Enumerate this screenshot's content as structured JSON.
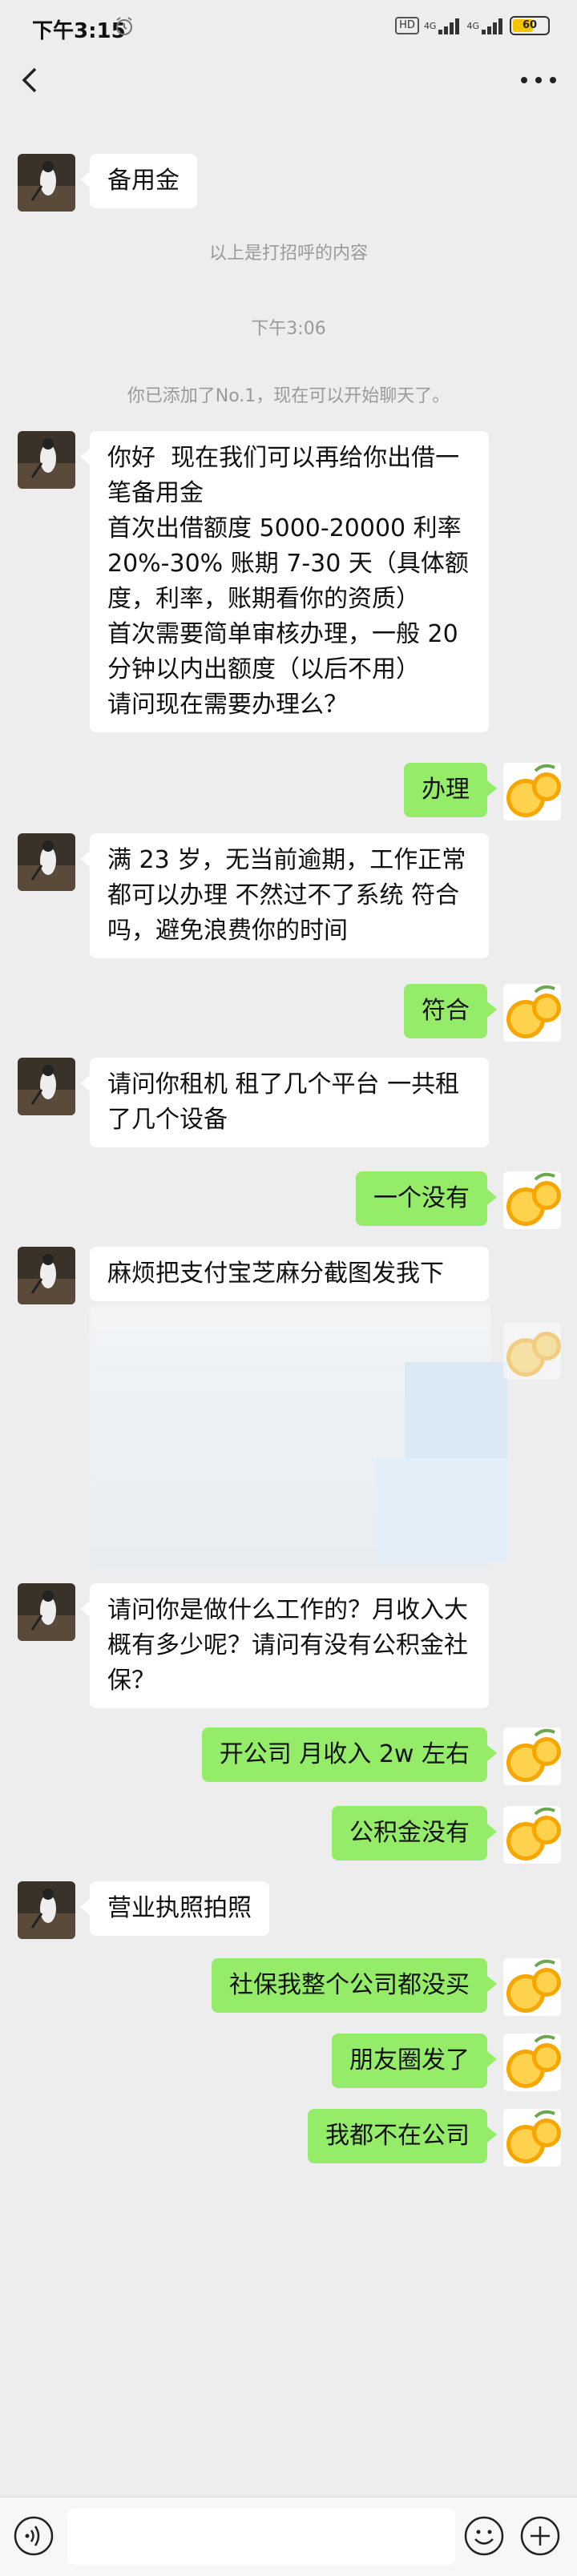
{
  "status_bar": {
    "time": "下午3:15",
    "hd": "HD",
    "net1": "4G",
    "net2": "4G",
    "battery": "60",
    "battery_level": 0.6
  },
  "header": {
    "back_icon": "chevron-left-icon",
    "more_icon": "more-dots-icon"
  },
  "chat": {
    "greeting": "备用金",
    "system_greeting_note": "以上是打招呼的内容",
    "timestamp": "下午3:06",
    "system_added_note": "你已添加了No.1，现在可以开始聊天了。",
    "messages": [
      {
        "side": "left",
        "text": "你好  现在我们可以再给你出借一笔备用金\n首次出借额度 5000-20000 利率 20%-30% 账期 7-30 天（具体额度，利率，账期看你的资质）\n首次需要简单审核办理，一般 20 分钟以内出额度（以后不用）\n请问现在需要办理么？"
      },
      {
        "side": "right",
        "text": "办理"
      },
      {
        "side": "left",
        "text": "满 23 岁，无当前逾期，工作正常都可以办理   不然过不了系统   符合吗，避免浪费你的时间"
      },
      {
        "side": "right",
        "text": "符合"
      },
      {
        "side": "left",
        "text": "请问你租机 租了几个平台 一共租了几个设备"
      },
      {
        "side": "right",
        "text": "一个没有"
      },
      {
        "side": "left",
        "text": "麻烦把支付宝芝麻分截图发我下"
      },
      {
        "side": "left",
        "text": "请问你是做什么工作的？月收入大概有多少呢？请问有没有公积金社保？"
      },
      {
        "side": "right",
        "text": "开公司    月收入 2w 左右"
      },
      {
        "side": "right",
        "text": "公积金没有"
      },
      {
        "side": "left",
        "text": "营业执照拍照"
      },
      {
        "side": "right",
        "text": "社保我整个公司都没买"
      },
      {
        "side": "right",
        "text": "朋友圈发了"
      },
      {
        "side": "right",
        "text": "我都不在公司"
      }
    ]
  },
  "input_bar": {
    "voice_icon": "voice-icon",
    "emoji_icon": "emoji-icon",
    "plus_icon": "plus-icon"
  }
}
